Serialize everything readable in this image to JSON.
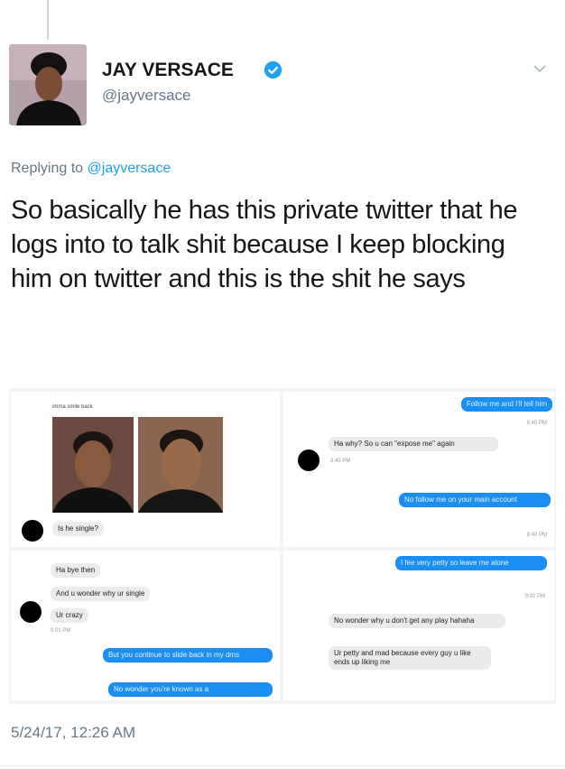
{
  "author": {
    "name": "JAY VERSACE",
    "handle": "@jayversace",
    "verified": true
  },
  "reply_prefix": "Replying to",
  "reply_handle": "@jayversace",
  "tweet_text": "So basically he has this private twitter that he logs into to talk shit because I keep blocking him on twitter and this is the shit he says",
  "timestamp": "5/24/17, 12:26 AM",
  "icons": {
    "verified": "verified-badge-icon",
    "menu": "chevron-down-icon"
  },
  "colors": {
    "link": "#1da1f2",
    "muted": "#657786",
    "imessage_blue": "#1a8ef2",
    "imessage_grey": "#ebebed"
  },
  "screenshots": {
    "top_left": {
      "caption": "imma smile back",
      "message": "Is he single?"
    },
    "top_right": {
      "sent_1": "Follow me and I'll tell him",
      "time_1": "8:40 PM",
      "received_1": "Ha why? So u can \"expose me\" again",
      "time_2": "8:40 PM",
      "sent_2": "No follow me on your main account",
      "time_3": "8:40 PM"
    },
    "bottom_left": {
      "received_1": "Ha bye then",
      "received_2": "And u wonder why ur single",
      "received_3": "Ur crazy",
      "time_1": "9:01 PM",
      "sent_1": "But you continue to slide back in my dms",
      "sent_2": "No wonder you're known as a"
    },
    "bottom_right": {
      "sent_1": "I fee very petty so leave me alone",
      "time_1": "9:02 PM",
      "received_1": "No wonder why u don't get any play hahaha",
      "received_2": "Ur petty and mad because every guy u like ends up liking me"
    }
  }
}
